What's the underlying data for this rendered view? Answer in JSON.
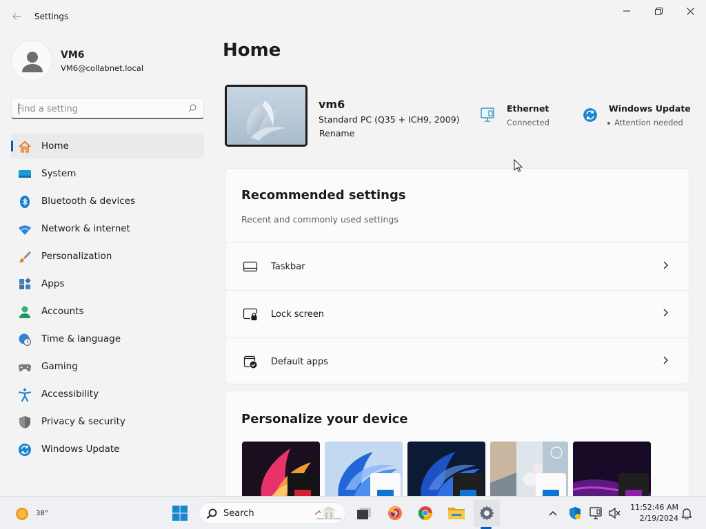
{
  "window": {
    "title": "Settings"
  },
  "user": {
    "name": "VM6",
    "email": "VM6@collabnet.local"
  },
  "search": {
    "placeholder": "Find a setting"
  },
  "nav": {
    "items": [
      {
        "label": "Home"
      },
      {
        "label": "System"
      },
      {
        "label": "Bluetooth & devices"
      },
      {
        "label": "Network & internet"
      },
      {
        "label": "Personalization"
      },
      {
        "label": "Apps"
      },
      {
        "label": "Accounts"
      },
      {
        "label": "Time & language"
      },
      {
        "label": "Gaming"
      },
      {
        "label": "Accessibility"
      },
      {
        "label": "Privacy & security"
      },
      {
        "label": "Windows Update"
      }
    ]
  },
  "main": {
    "title": "Home",
    "device": {
      "name": "vm6",
      "model": "Standard PC (Q35 + ICH9, 2009)",
      "rename": "Rename"
    },
    "ethernet": {
      "title": "Ethernet",
      "status": "Connected"
    },
    "update": {
      "title": "Windows Update",
      "status": "Attention needed"
    },
    "recommended": {
      "title": "Recommended settings",
      "subtitle": "Recent and commonly used settings",
      "items": [
        {
          "label": "Taskbar"
        },
        {
          "label": "Lock screen"
        },
        {
          "label": "Default apps"
        }
      ]
    },
    "personalize": {
      "title": "Personalize your device"
    }
  },
  "taskbar": {
    "weather_temp": "38°",
    "search_label": "Search",
    "time": "11:52:46 AM",
    "date": "2/19/2024"
  },
  "colors": {
    "accent": "#005fb8"
  }
}
